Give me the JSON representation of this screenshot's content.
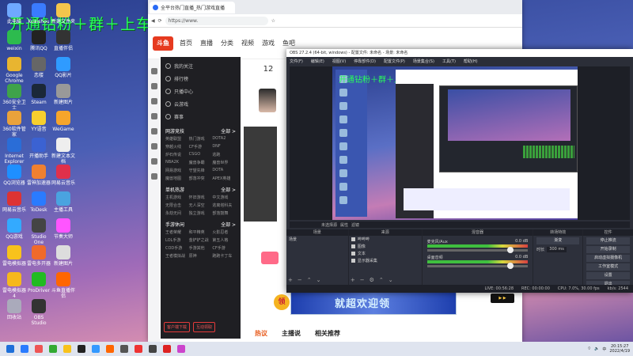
{
  "overlay": {
    "title": "开通钻粉＋群＋上车＋点歌"
  },
  "desktop_icons": [
    {
      "label": "此电脑",
      "color": "#6fa8ff"
    },
    {
      "label": "Kuaishou",
      "color": "#3a7bff"
    },
    {
      "label": "新建文件夹",
      "color": "#f3c54c"
    },
    {
      "label": "weixin",
      "color": "#2dbb4e"
    },
    {
      "label": "腾讯QQ",
      "color": "#222"
    },
    {
      "label": "直播伴侣",
      "color": "#333"
    },
    {
      "label": "Google Chrome",
      "color": "#e8b530"
    },
    {
      "label": "恋楼",
      "color": "#666"
    },
    {
      "label": "QQ影片",
      "color": "#2f9bff"
    },
    {
      "label": "360安全卫士",
      "color": "#3fa34a"
    },
    {
      "label": "Steam",
      "color": "#1b2838"
    },
    {
      "label": "新建图片",
      "color": "#999"
    },
    {
      "label": "360软件管家",
      "color": "#e9a23b"
    },
    {
      "label": "YY语音",
      "color": "#f6cf2e"
    },
    {
      "label": "WeGame",
      "color": "#f6a52b"
    },
    {
      "label": "Internet Explorer",
      "color": "#2a6dd7"
    },
    {
      "label": "开播助手",
      "color": "#3b62d2"
    },
    {
      "label": "新建文本文档",
      "color": "#eee"
    },
    {
      "label": "QQ浏览器",
      "color": "#1e8fff"
    },
    {
      "label": "雷神加速器",
      "color": "#f08030"
    },
    {
      "label": "网易云音乐",
      "color": "#e0304b"
    },
    {
      "label": "网易云音乐",
      "color": "#d33"
    },
    {
      "label": "ToDesk",
      "color": "#2a7bff"
    },
    {
      "label": "主播工具",
      "color": "#4aa3e0"
    },
    {
      "label": "QQ游戏",
      "color": "#3af"
    },
    {
      "label": "Studio One",
      "color": "#444"
    },
    {
      "label": "节奏大师",
      "color": "#f5f"
    },
    {
      "label": "雷电模拟器",
      "color": "#f8c21c"
    },
    {
      "label": "雷电多开器",
      "color": "#f06a2b"
    },
    {
      "label": "新建图片",
      "color": "#ddd"
    },
    {
      "label": "雷电模拟器4",
      "color": "#f6b81d"
    },
    {
      "label": "ProDriver",
      "color": "#2b2"
    },
    {
      "label": "斗鱼直播伴侣",
      "color": "#f60"
    },
    {
      "label": "回收站",
      "color": "#aab"
    },
    {
      "label": "OBS Studio",
      "color": "#333"
    }
  ],
  "browser": {
    "tab_title": "全平台热门直播_热门游戏直播",
    "url": "https://www.",
    "site_name": "斗鱼",
    "nav": [
      "首页",
      "直播",
      "分类",
      "视频",
      "游戏",
      "鱼吧"
    ],
    "date_day": "12",
    "side": {
      "top_items": [
        "我的关注",
        "排行榜",
        "只播中心",
        "云游戏"
      ],
      "title_row": "赛事",
      "section1": "网游竞技",
      "section1_more": "全部 >",
      "grid1": [
        "英雄联盟",
        "热门游戏",
        "DOTA2",
        "穿越火线",
        "CF手游",
        "DNF",
        "炉石传说",
        "CSGO",
        "逃跑",
        "NBA2K",
        "魔兽争霸",
        "魔兽世界",
        "网易游戏",
        "守望先锋",
        "DOTA",
        "魔兽地图",
        "部落冲突",
        "APEX英雄"
      ],
      "section2": "单机热游",
      "section2_more": "全部 >",
      "grid2": [
        "主机游戏",
        "怀旧游戏",
        "中文游戏",
        "无限合击",
        "无人深空",
        "逃离塔科夫",
        "永劫无间",
        "独立游戏",
        "部落鼓舞"
      ],
      "section3": "手游休闲",
      "section3_more": "全部 >",
      "grid3": [
        "王者荣耀",
        "和平精英",
        "火影忍者",
        "LOL手游",
        "金铲铲之战",
        "第五人格",
        "COD手游",
        "手游其他",
        "CF手游",
        "王者模拟战",
        "原神",
        "跑跑卡丁车"
      ],
      "btn_left": "客户端下载",
      "btn_right": "互动领取"
    },
    "banner_text": "就超欢迎领",
    "badge": "领",
    "bottom_tabs": [
      "热议",
      "主播说",
      "相关推荐"
    ]
  },
  "obs": {
    "title": "OBS 27.2.4 (64-bit, windows) - 配置文件: 未命名 - 场景: 未命名",
    "menu": [
      "文件(F)",
      "编辑(E)",
      "视图(V)",
      "停靠部件(D)",
      "配置文件(P)",
      "场景集合(S)",
      "工具(T)",
      "帮助(H)"
    ],
    "preview_title": "开通钻粉＋群＋上车＋点歌",
    "source_bar": [
      "未选择源",
      "属性",
      "滤镜"
    ],
    "docks": {
      "scenes_title": "场景",
      "scenes": [
        "场景"
      ],
      "sources_title": "来源",
      "sources": [
        "哔哔哔",
        "图像",
        "文本",
        "显示器采集"
      ],
      "mixer_title": "混音器",
      "mixer": [
        {
          "name": "麦克风/Aux",
          "db": "0.0 dB"
        },
        {
          "name": "桌面音频",
          "db": "0.0 dB"
        }
      ],
      "transitions_title": "转场特效",
      "transition_type": "渐变",
      "duration_label": "时长",
      "duration_value": "300 ms",
      "controls_title": "控件",
      "controls": [
        "停止推流",
        "开始录制",
        "启动虚拟摄像机",
        "工作室模式",
        "设置",
        "退出"
      ]
    },
    "status": {
      "live": "LIVE: 00:56:28",
      "rec": "REC: 00:00:00",
      "cpu": "CPU: 7.0%, 30.00 fps",
      "kbps": "kb/s: 2544"
    }
  },
  "taskbar": {
    "icons": [
      "#1e6fd9",
      "#2a7bff",
      "#e55",
      "#3a3",
      "#f8c21c",
      "#222",
      "#39f",
      "#f60",
      "#555",
      "#e33",
      "#444",
      "#d22",
      "#c4c"
    ],
    "clock_time": "20:15:27",
    "clock_date": "2022/4/19",
    "lang": "中"
  }
}
